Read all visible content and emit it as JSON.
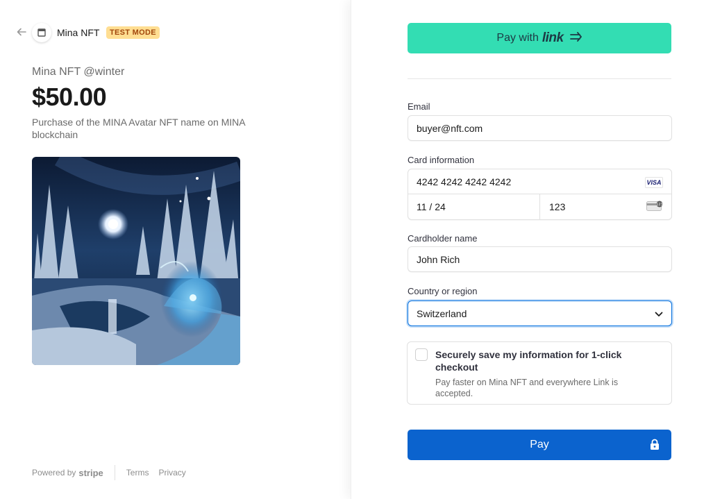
{
  "header": {
    "merchant_name": "Mina NFT",
    "test_mode_badge": "TEST MODE"
  },
  "product": {
    "name": "Mina NFT @winter",
    "price": "$50.00",
    "description": "Purchase of the MINA Avatar NFT name on MINA blockchain"
  },
  "footer": {
    "powered_by": "Powered by",
    "stripe_brand": "stripe",
    "terms": "Terms",
    "privacy": "Privacy"
  },
  "link_button": {
    "prefix": "Pay with",
    "brand": "link"
  },
  "form": {
    "email_label": "Email",
    "email_value": "buyer@nft.com",
    "card_label": "Card information",
    "card_number": "4242 4242 4242 4242",
    "card_expiry": "11 / 24",
    "card_cvc": "123",
    "card_brand": "VISA",
    "cardholder_label": "Cardholder name",
    "cardholder_value": "John Rich",
    "country_label": "Country or region",
    "country_value": "Switzerland"
  },
  "save_info": {
    "title": "Securely save my information for 1-click checkout",
    "subtitle": "Pay faster on Mina NFT and everywhere Link is accepted."
  },
  "pay_button": {
    "label": "Pay"
  },
  "colors": {
    "link_green": "#33ddb3",
    "pay_blue": "#0b63ce",
    "badge_bg": "#ffde92",
    "badge_text": "#a2470c"
  }
}
